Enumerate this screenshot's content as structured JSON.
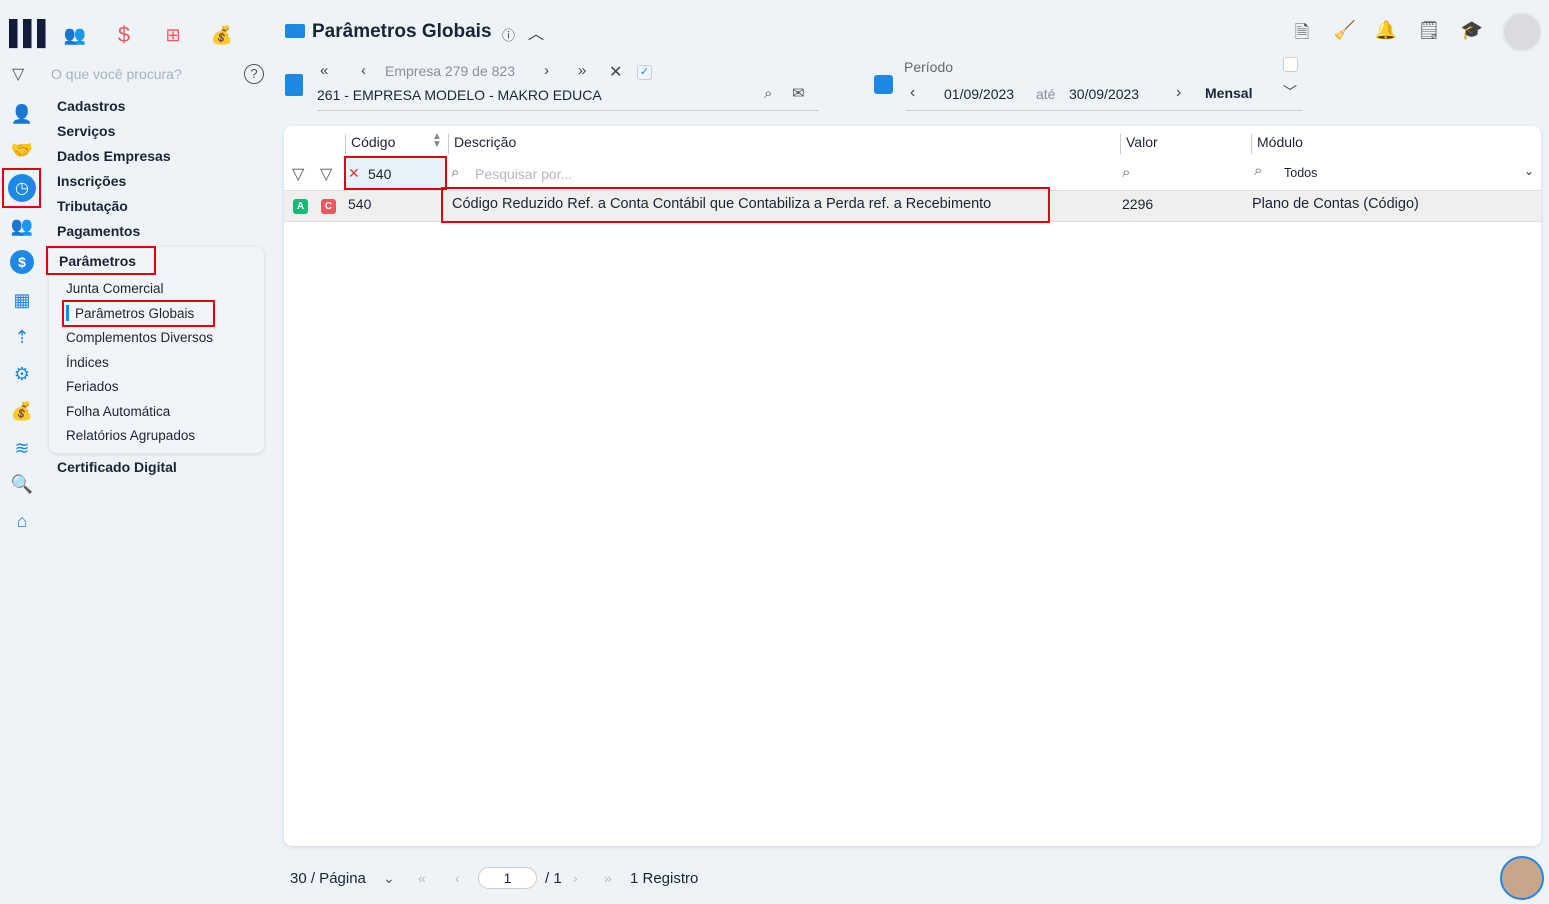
{
  "app": {
    "search_placeholder": "O que você procura?",
    "help": "?"
  },
  "top_modules": [
    {
      "icon": "people-icon",
      "color": "#1fb57a"
    },
    {
      "icon": "dollar-icon",
      "color": "#f0565f"
    },
    {
      "icon": "calculator-icon",
      "color": "#f0565f"
    },
    {
      "icon": "money-bag-icon",
      "color": "#666666"
    }
  ],
  "nav": {
    "items": [
      "Cadastros",
      "Serviços",
      "Dados Empresas",
      "Inscrições",
      "Tributação",
      "Pagamentos"
    ],
    "group": "Parâmetros",
    "sub_items": [
      "Junta Comercial",
      "Parâmetros Globais",
      "Complementos Diversos",
      "Índices",
      "Feriados",
      "Folha Automática",
      "Relatórios Agrupados"
    ],
    "after": "Certificado Digital"
  },
  "header": {
    "title": "Parâmetros Globais",
    "info": "ⓘ"
  },
  "empresa": {
    "nav_label": "Empresa 279 de 823",
    "name": "261 - EMPRESA MODELO - MAKRO EDUCA"
  },
  "periodo": {
    "label": "Período",
    "start": "01/09/2023",
    "sep": "até",
    "end": "30/09/2023",
    "mode": "Mensal"
  },
  "table": {
    "columns": [
      "Código",
      "Descrição",
      "Valor",
      "Módulo"
    ],
    "filters": {
      "codigo": "540",
      "descricao_placeholder": "Pesquisar por...",
      "modulo": "Todos"
    },
    "rows": [
      {
        "badges": [
          "A",
          "C"
        ],
        "codigo": "540",
        "descricao": "Código Reduzido Ref. a Conta Contábil que Contabiliza a Perda ref. a Recebimento",
        "valor": "2296",
        "modulo": "Plano de Contas (Código)"
      }
    ]
  },
  "pagination": {
    "per_page": "30 / Página",
    "page": "1",
    "total_pages": "/ 1",
    "records": "1 Registro"
  },
  "colors": {
    "accent": "#1e88e5",
    "highlight": "#e3000f",
    "badge_a": "#19b877",
    "badge_c": "#f0565f"
  }
}
